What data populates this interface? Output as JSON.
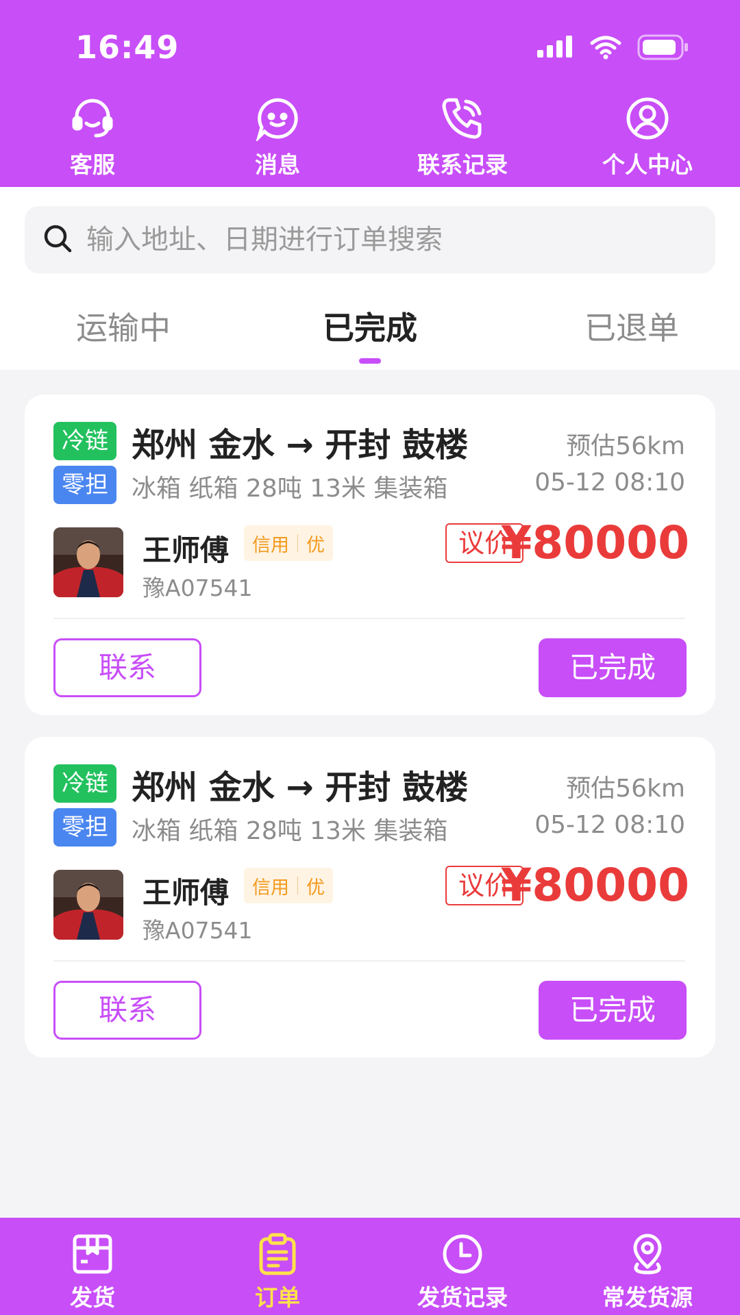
{
  "status_bar": {
    "time": "16:49"
  },
  "top_nav": [
    {
      "label": "客服",
      "icon": "headset-icon"
    },
    {
      "label": "消息",
      "icon": "message-icon"
    },
    {
      "label": "联系记录",
      "icon": "phone-icon"
    },
    {
      "label": "个人中心",
      "icon": "user-icon"
    }
  ],
  "search": {
    "placeholder": "输入地址、日期进行订单搜索",
    "value": ""
  },
  "tabs": [
    {
      "label": "运输中",
      "active": false
    },
    {
      "label": "已完成",
      "active": true
    },
    {
      "label": "已退单",
      "active": false
    }
  ],
  "orders": [
    {
      "tag1": "冷链",
      "tag2": "零担",
      "route": "郑州 金水 → 开封 鼓楼",
      "distance": "预估56km",
      "goods": "冰箱 纸箱 28吨 13米  集装箱",
      "datetime": "05-12 08:10",
      "driver_name": "王师傅",
      "credit_label": "信用",
      "credit_level": "优",
      "plate": "豫A07541",
      "price_type": "议价",
      "price": "¥80000",
      "contact_label": "联系",
      "status_label": "已完成"
    },
    {
      "tag1": "冷链",
      "tag2": "零担",
      "route": "郑州 金水 → 开封 鼓楼",
      "distance": "预估56km",
      "goods": "冰箱 纸箱 28吨 13米  集装箱",
      "datetime": "05-12 08:10",
      "driver_name": "王师傅",
      "credit_label": "信用",
      "credit_level": "优",
      "plate": "豫A07541",
      "price_type": "议价",
      "price": "¥80000",
      "contact_label": "联系",
      "status_label": "已完成"
    }
  ],
  "bottom_nav": [
    {
      "label": "发货",
      "icon": "package-icon",
      "active": false
    },
    {
      "label": "订单",
      "icon": "order-icon",
      "active": true
    },
    {
      "label": "发货记录",
      "icon": "clock-icon",
      "active": false
    },
    {
      "label": "常发货源",
      "icon": "location-pin-icon",
      "active": false
    }
  ],
  "colors": {
    "primary": "#c84ef8",
    "price": "#ea3b3b",
    "active_bottom_nav": "#ffe24a",
    "badge_cold_chain": "#22c15e",
    "badge_less_than_truckload": "#4a86f0"
  }
}
